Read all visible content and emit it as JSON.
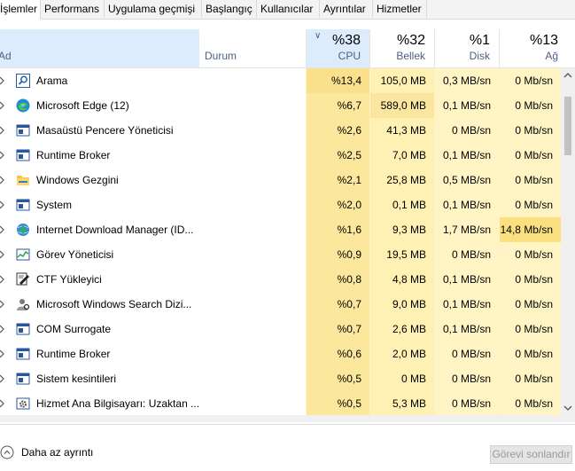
{
  "tabs": [
    "İşlemler",
    "Performans",
    "Uygulama geçmişi",
    "Başlangıç",
    "Kullanıcılar",
    "Ayrıntılar",
    "Hizmetler"
  ],
  "header": {
    "name": "Ad",
    "status": "Durum",
    "cpu": {
      "pct": "%38",
      "label": "CPU"
    },
    "mem": {
      "pct": "%32",
      "label": "Bellek"
    },
    "disk": {
      "pct": "%1",
      "label": "Disk"
    },
    "net": {
      "pct": "%13",
      "label": "Ağ"
    }
  },
  "rows": [
    {
      "name": "Arama",
      "icon": "search-icon",
      "cpu": "%13,4",
      "mem": "105,0 MB",
      "disk": "0,3 MB/sn",
      "net": "0 Mb/sn"
    },
    {
      "name": "Microsoft Edge (12)",
      "icon": "edge-icon",
      "cpu": "%6,7",
      "mem": "589,0 MB",
      "disk": "0,1 MB/sn",
      "net": "0 Mb/sn"
    },
    {
      "name": "Masaüstü Pencere Yöneticisi",
      "icon": "window-icon",
      "cpu": "%2,6",
      "mem": "41,3 MB",
      "disk": "0 MB/sn",
      "net": "0 Mb/sn"
    },
    {
      "name": "Runtime Broker",
      "icon": "window-icon",
      "cpu": "%2,5",
      "mem": "7,0 MB",
      "disk": "0,1 MB/sn",
      "net": "0 Mb/sn"
    },
    {
      "name": "Windows Gezgini",
      "icon": "folder-icon",
      "cpu": "%2,1",
      "mem": "25,8 MB",
      "disk": "0,5 MB/sn",
      "net": "0 Mb/sn"
    },
    {
      "name": "System",
      "icon": "window-icon",
      "cpu": "%2,0",
      "mem": "0,1 MB",
      "disk": "0,1 MB/sn",
      "net": "0 Mb/sn"
    },
    {
      "name": "Internet Download Manager (ID...",
      "icon": "download-globe-icon",
      "cpu": "%1,6",
      "mem": "9,3 MB",
      "disk": "1,7 MB/sn",
      "net": "14,8 Mb/sn"
    },
    {
      "name": "Görev Yöneticisi",
      "icon": "task-manager-icon",
      "cpu": "%0,9",
      "mem": "19,5 MB",
      "disk": "0 MB/sn",
      "net": "0 Mb/sn"
    },
    {
      "name": "CTF Yükleyici",
      "icon": "pen-icon",
      "cpu": "%0,8",
      "mem": "4,8 MB",
      "disk": "0,1 MB/sn",
      "net": "0 Mb/sn"
    },
    {
      "name": "Microsoft Windows Search Dizi...",
      "icon": "user-search-icon",
      "cpu": "%0,7",
      "mem": "9,0 MB",
      "disk": "0,1 MB/sn",
      "net": "0 Mb/sn"
    },
    {
      "name": "COM Surrogate",
      "icon": "window-icon",
      "cpu": "%0,7",
      "mem": "2,6 MB",
      "disk": "0,1 MB/sn",
      "net": "0 Mb/sn"
    },
    {
      "name": "Runtime Broker",
      "icon": "window-icon",
      "cpu": "%0,6",
      "mem": "2,0 MB",
      "disk": "0 MB/sn",
      "net": "0 Mb/sn"
    },
    {
      "name": "Sistem kesintileri",
      "icon": "window-icon",
      "cpu": "%0,5",
      "mem": "0 MB",
      "disk": "0 MB/sn",
      "net": "0 Mb/sn"
    },
    {
      "name": "Hizmet Ana Bilgisayarı: Uzaktan ...",
      "icon": "gear-icon",
      "cpu": "%0,5",
      "mem": "5,3 MB",
      "disk": "0 MB/sn",
      "net": "0 Mb/sn"
    }
  ],
  "footer": {
    "less_details": "Daha az ayrıntı",
    "end_task": "Görevi sonlandır"
  },
  "colors": {
    "accent_header": "#dcecfc",
    "heat_high": "#fbe08c",
    "heat_low": "#fff4c4"
  }
}
